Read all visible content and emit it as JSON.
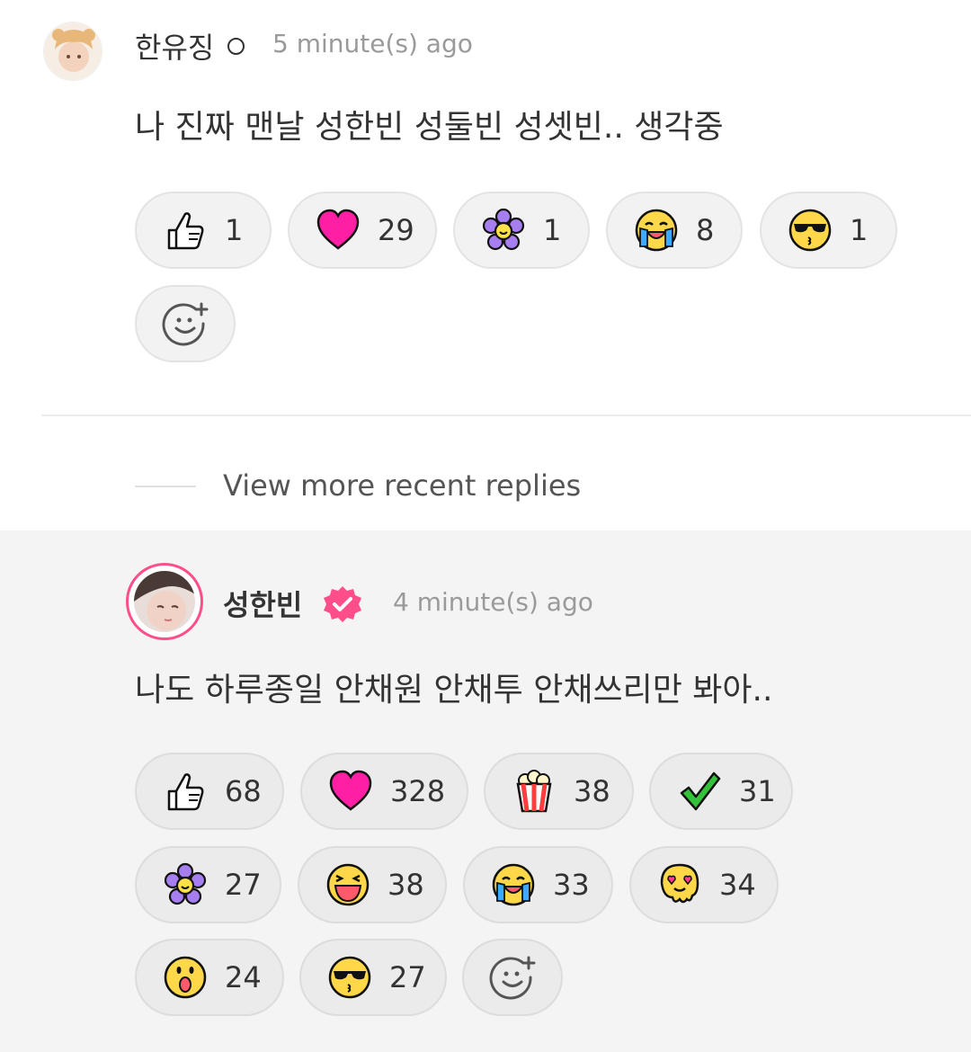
{
  "comment1": {
    "author": "한유징",
    "time": "5 minute(s) ago",
    "text": "나 진짜 맨날 성한빈 성둘빈 성셋빈.. 생각중",
    "reactions": [
      {
        "icon": "thumbs-up-icon",
        "count": "1"
      },
      {
        "icon": "heart-icon",
        "count": "29"
      },
      {
        "icon": "flower-icon",
        "count": "1"
      },
      {
        "icon": "crying-face-icon",
        "count": "8"
      },
      {
        "icon": "sunglasses-kiss-face-icon",
        "count": "1"
      }
    ]
  },
  "view_more": "View more recent replies",
  "comment2": {
    "author": "성한빈",
    "time": "4 minute(s) ago",
    "text": "나도 하루종일 안채원 안채투 안채쓰리만 봐아..",
    "reactions": [
      {
        "icon": "thumbs-up-icon",
        "count": "68"
      },
      {
        "icon": "heart-icon",
        "count": "328"
      },
      {
        "icon": "popcorn-icon",
        "count": "38"
      },
      {
        "icon": "check-icon",
        "count": "31"
      },
      {
        "icon": "flower-icon",
        "count": "27"
      },
      {
        "icon": "laughing-face-icon",
        "count": "38"
      },
      {
        "icon": "crying-face-icon",
        "count": "33"
      },
      {
        "icon": "melting-heart-eyes-icon",
        "count": "34"
      },
      {
        "icon": "surprised-face-icon",
        "count": "24"
      },
      {
        "icon": "sunglasses-kiss-face-icon",
        "count": "27"
      }
    ]
  },
  "colors": {
    "accent_pink": "#ff4e8a",
    "heart": "#ff1fa5"
  }
}
